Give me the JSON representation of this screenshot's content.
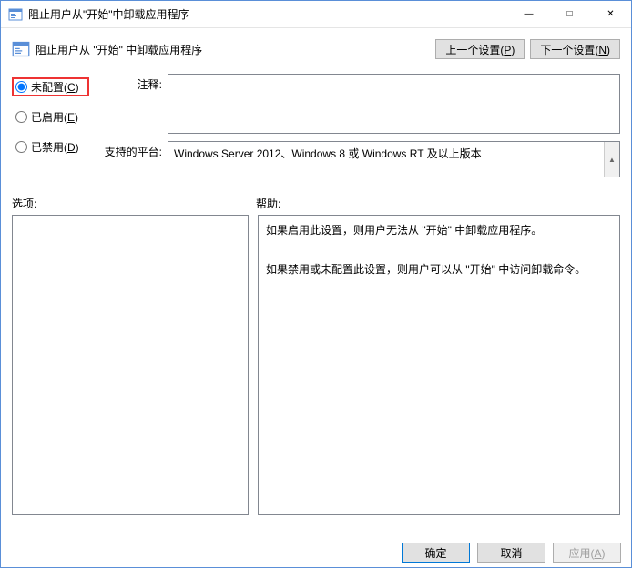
{
  "titlebar": {
    "title": "阻止用户从\"开始\"中卸载应用程序"
  },
  "header": {
    "title": "阻止用户从 \"开始\" 中卸载应用程序",
    "prev_prefix": "上一个设置(",
    "prev_key": "P",
    "prev_suffix": ")",
    "next_prefix": "下一个设置(",
    "next_key": "N",
    "next_suffix": ")"
  },
  "radios": {
    "not_configured_prefix": "未配置(",
    "not_configured_key": "C",
    "not_configured_suffix": ")",
    "enabled_prefix": "已启用(",
    "enabled_key": "E",
    "enabled_suffix": ")",
    "disabled_prefix": "已禁用(",
    "disabled_key": "D",
    "disabled_suffix": ")"
  },
  "fields": {
    "comment_label": "注释:",
    "comment_value": "",
    "platform_label": "支持的平台:",
    "platform_value": "Windows Server 2012、Windows 8 或 Windows RT 及以上版本"
  },
  "labels": {
    "options": "选项:",
    "help": "帮助:"
  },
  "help": {
    "text": "如果启用此设置，则用户无法从 \"开始\" 中卸载应用程序。\n\n如果禁用或未配置此设置，则用户可以从 \"开始\" 中访问卸载命令。"
  },
  "footer": {
    "ok": "确定",
    "cancel": "取消",
    "apply_prefix": "应用(",
    "apply_key": "A",
    "apply_suffix": ")"
  }
}
